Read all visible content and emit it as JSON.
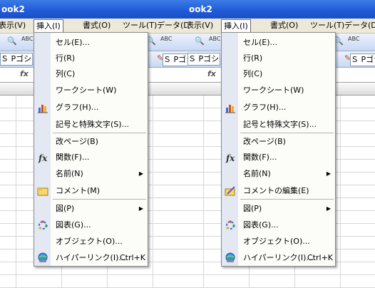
{
  "title_fragment": "ook2",
  "menubar_items": [
    "表示(V)",
    "挿入(I)",
    "書式(O)",
    "ツール(T)",
    "データ(D)"
  ],
  "font_fragment": "Ｓ Pゴシック",
  "fx_label": "fx",
  "menu_left": {
    "items": [
      {
        "label": "セル(E)..."
      },
      {
        "label": "行(R)"
      },
      {
        "label": "列(C)"
      },
      {
        "label": "ワークシート(W)"
      },
      {
        "label": "グラフ(H)...",
        "icon": "chart-icon"
      },
      {
        "label": "記号と特殊文字(S)..."
      },
      {
        "label": "改ページ(B)"
      },
      {
        "label": "関数(F)...",
        "icon": "function-icon"
      },
      {
        "label": "名前(N)",
        "submenu": "▶"
      },
      {
        "label": "コメント(M)",
        "icon": "comment-icon"
      },
      {
        "label": "図(P)",
        "submenu": "▶"
      },
      {
        "label": "図表(G)...",
        "icon": "diagram-icon"
      },
      {
        "label": "オブジェクト(O)..."
      },
      {
        "label": "ハイパーリンク(I)...",
        "shortcut": "Ctrl+K",
        "icon": "hyperlink-icon"
      }
    ]
  },
  "menu_right": {
    "items": [
      {
        "label": "セル(E)..."
      },
      {
        "label": "行(R)"
      },
      {
        "label": "列(C)"
      },
      {
        "label": "ワークシート(W)"
      },
      {
        "label": "グラフ(H)...",
        "icon": "chart-icon"
      },
      {
        "label": "記号と特殊文字(S)..."
      },
      {
        "label": "改ページ(B)"
      },
      {
        "label": "関数(F)...",
        "icon": "function-icon"
      },
      {
        "label": "名前(N)",
        "submenu": "▶"
      },
      {
        "label": "コメントの編集(E)",
        "icon": "edit-comment-icon"
      },
      {
        "label": "図(P)",
        "submenu": "▶"
      },
      {
        "label": "図表(G)...",
        "icon": "diagram-icon"
      },
      {
        "label": "オブジェクト(O)..."
      },
      {
        "label": "ハイパーリンク(I)...",
        "shortcut": "Ctrl+K",
        "icon": "hyperlink-icon"
      }
    ]
  }
}
